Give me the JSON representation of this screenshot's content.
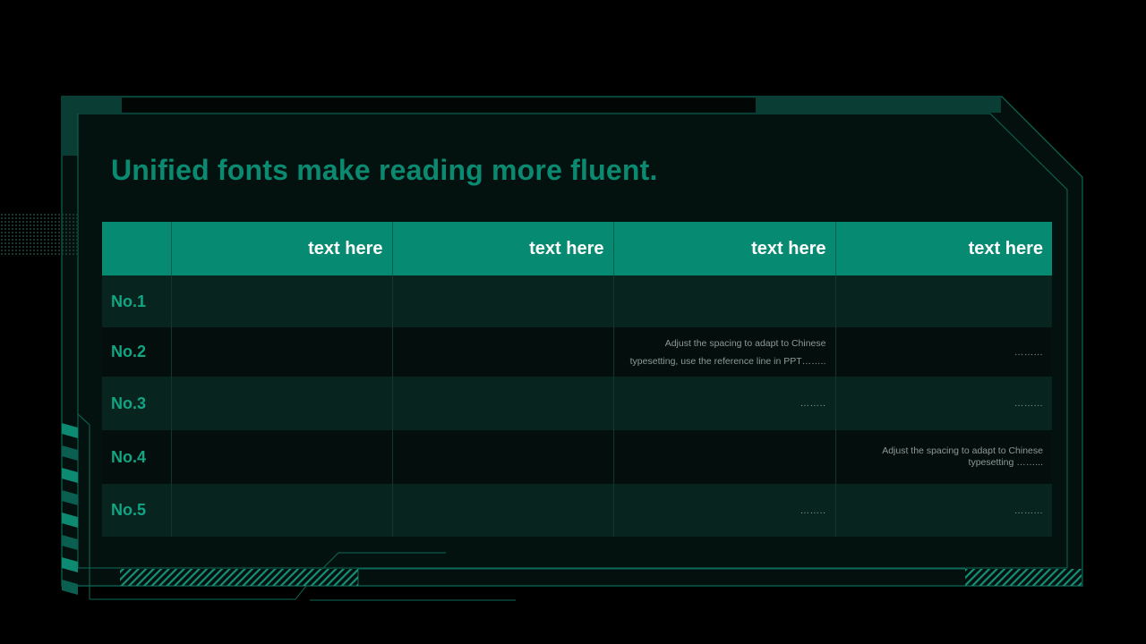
{
  "slide": {
    "title": "Unified fonts make reading more fluent."
  },
  "table": {
    "headers": [
      "",
      "text here",
      "text here",
      "text here",
      "text here"
    ],
    "rows": [
      {
        "label": "No.1",
        "cells": [
          "",
          "",
          "",
          ""
        ]
      },
      {
        "label": "No.2",
        "cells": [
          "",
          "",
          "Adjust the spacing to adapt to Chinese typesetting, use the reference line in PPT……..",
          "……..."
        ]
      },
      {
        "label": "No.3",
        "cells": [
          "",
          "",
          "……..",
          "……..."
        ]
      },
      {
        "label": "No.4",
        "cells": [
          "",
          "",
          "",
          "Adjust the spacing to adapt to Chinese typesetting ……..."
        ]
      },
      {
        "label": "No.5",
        "cells": [
          "",
          "",
          "……..",
          "……..."
        ]
      }
    ]
  },
  "colors": {
    "accent": "#068a72",
    "title": "#0a8a70",
    "label": "#11a583",
    "background": "#000000",
    "panel": "#04120f"
  }
}
